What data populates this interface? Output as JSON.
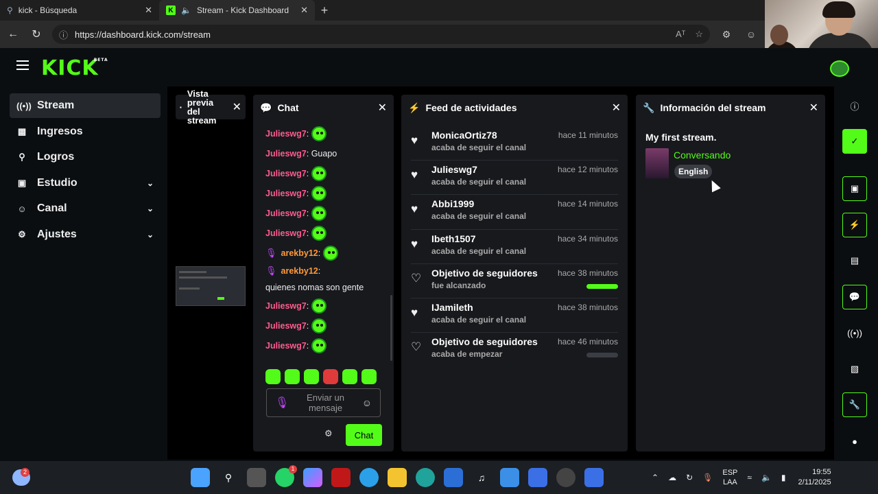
{
  "browser": {
    "tabs": [
      {
        "title": "kick - Búsqueda"
      },
      {
        "title": "Stream - Kick Dashboard"
      }
    ],
    "url": "https://dashboard.kick.com/stream"
  },
  "app": {
    "logo": "KICK",
    "logo_badge": "BETA"
  },
  "sidebar": {
    "items": [
      {
        "label": "Stream"
      },
      {
        "label": "Ingresos"
      },
      {
        "label": "Logros"
      },
      {
        "label": "Estudio"
      },
      {
        "label": "Canal"
      },
      {
        "label": "Ajustes"
      }
    ]
  },
  "preview": {
    "title": "Vista previa del stream"
  },
  "chat": {
    "title": "Chat",
    "messages": [
      {
        "user": "Julieswg7",
        "text": ""
      },
      {
        "user": "Julieswg7",
        "text": "Guapo"
      },
      {
        "user": "Julieswg7",
        "text": ""
      },
      {
        "user": "Julieswg7",
        "text": ""
      },
      {
        "user": "Julieswg7",
        "text": ""
      },
      {
        "user": "Julieswg7",
        "text": ""
      },
      {
        "user": "arekby12",
        "text": ""
      },
      {
        "user": "arekby12",
        "text": "quienes nomas son gente"
      },
      {
        "user": "Julieswg7",
        "text": ""
      },
      {
        "user": "Julieswg7",
        "text": ""
      },
      {
        "user": "Julieswg7",
        "text": ""
      }
    ],
    "input_placeholder": "Enviar un mensaje",
    "send_label": "Chat"
  },
  "feed": {
    "title": "Feed de actividades",
    "items": [
      {
        "name": "MonicaOrtiz78",
        "sub": "acaba de seguir el canal",
        "time": "hace 11 minutos"
      },
      {
        "name": "Julieswg7",
        "sub": "acaba de seguir el canal",
        "time": "hace 12 minutos"
      },
      {
        "name": "Abbi1999",
        "sub": "acaba de seguir el canal",
        "time": "hace 14 minutos"
      },
      {
        "name": "Ibeth1507",
        "sub": "acaba de seguir el canal",
        "time": "hace 34 minutos"
      },
      {
        "name": "Objetivo de seguidores",
        "sub": "fue alcanzado",
        "time": "hace 38 minutos",
        "progress": 1.0
      },
      {
        "name": "IJamileth",
        "sub": "acaba de seguir el canal",
        "time": "hace 38 minutos"
      },
      {
        "name": "Objetivo de seguidores",
        "sub": "acaba de empezar",
        "time": "hace 46 minutos",
        "progress": 0.0
      }
    ]
  },
  "info": {
    "title": "Información del stream",
    "stream_title": "My first stream.",
    "category": "Conversando",
    "language": "English"
  },
  "taskbar": {
    "weather_badge": "2",
    "whatsapp_badge": "1",
    "lang_1": "ESP",
    "lang_2": "LAA",
    "time": "19:55",
    "date": "2/11/2025"
  },
  "colors": {
    "accent": "#53fc18",
    "username": "#ff5c8d",
    "username_alt": "#ff9a3c",
    "mic": "#c247ff"
  }
}
